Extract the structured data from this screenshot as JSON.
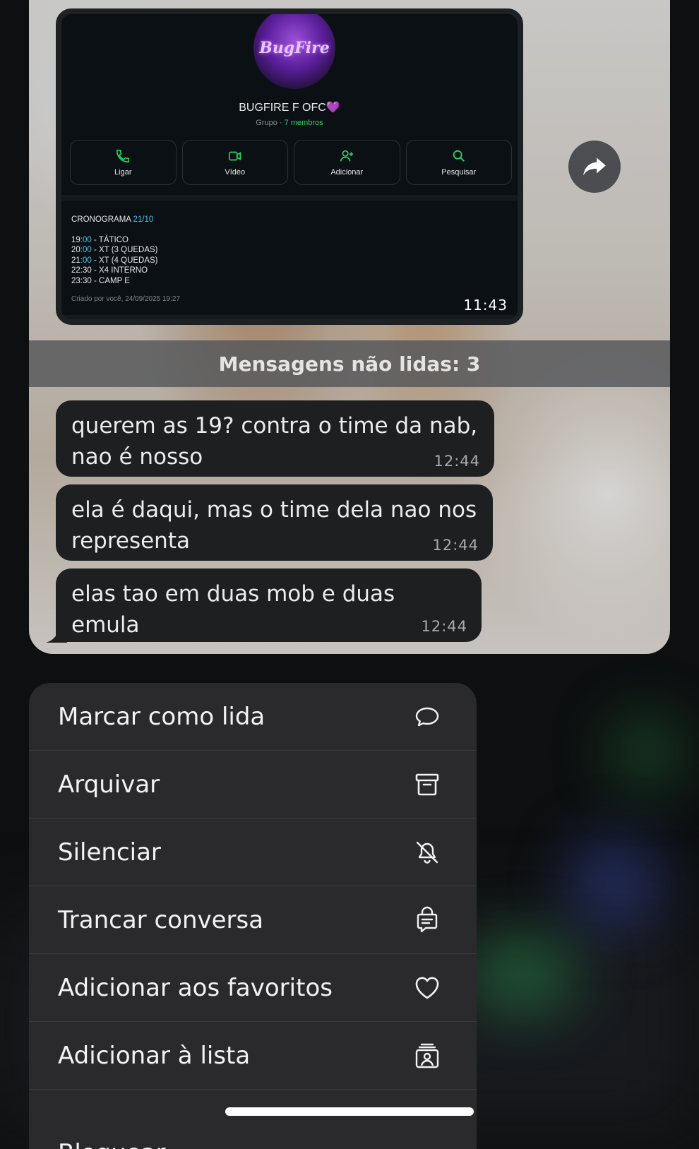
{
  "preview": {
    "card": {
      "avatar_text": "BugFire",
      "group_name": "BUGFIRE F OFC💜",
      "group_sub_prefix": "Grupo · ",
      "group_sub_members": "7 membros",
      "actions": [
        {
          "label": "Ligar",
          "icon": "phone-icon"
        },
        {
          "label": "Vídeo",
          "icon": "video-icon"
        },
        {
          "label": "Adicionar",
          "icon": "add-person-icon"
        },
        {
          "label": "Pesquisar",
          "icon": "search-icon"
        }
      ],
      "description_title": "CRONOGRAMA ",
      "description_title_date": "21/10",
      "schedule": [
        {
          "h": "19",
          "m": ":00",
          "text": " - TÁTICO"
        },
        {
          "h": "20",
          "m": ":00",
          "text": " - XT (3 QUEDAS)"
        },
        {
          "h": "21",
          "m": ":00",
          "text": " - XT (4 QUEDAS)"
        },
        {
          "h": "22",
          "m": ":30",
          "text": " - X4 INTERNO"
        },
        {
          "h": "23",
          "m": ":30",
          "text": " - CAMP E"
        }
      ],
      "created": "Criado por você, 24/09/2025 19:27",
      "time": "11:43"
    },
    "unread": "Mensagens não lidas: 3",
    "messages": [
      {
        "text": "querem as 19? contra o time da nab, nao é nosso",
        "time": "12:44"
      },
      {
        "text": "ela é daqui, mas o time dela nao nos representa",
        "time": "12:44"
      },
      {
        "text": "elas tao em duas mob e duas emula",
        "time": "12:44"
      }
    ]
  },
  "menu": {
    "items": [
      {
        "label": "Marcar como lida",
        "icon": "chat-bubble-icon"
      },
      {
        "label": "Arquivar",
        "icon": "archive-icon"
      },
      {
        "label": "Silenciar",
        "icon": "bell-off-icon"
      },
      {
        "label": "Trancar conversa",
        "icon": "locked-chat-icon"
      },
      {
        "label": "Adicionar aos favoritos",
        "icon": "heart-icon"
      },
      {
        "label": "Adicionar à lista",
        "icon": "list-person-icon"
      },
      {
        "label": "Bloquear",
        "icon": ""
      }
    ]
  },
  "colors": {
    "accent_green": "#25d366",
    "accent_blue": "#53bdeb",
    "bubble": "#1d1f21",
    "menu": "#2a2a2c"
  }
}
